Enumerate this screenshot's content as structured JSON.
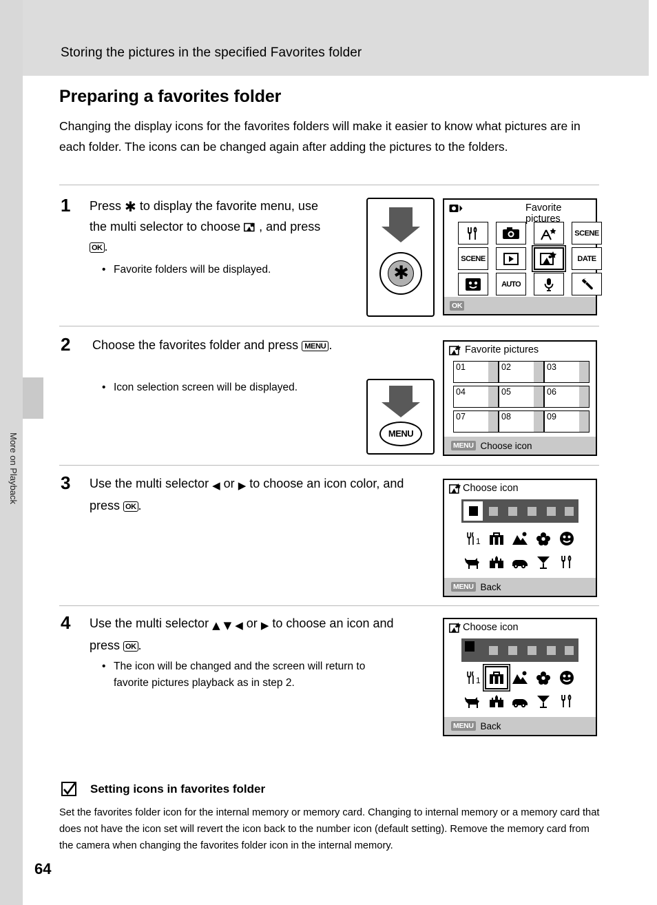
{
  "header": {
    "running_title": "Storing the pictures in the specified Favorites folder"
  },
  "page": {
    "number": "64",
    "side_label": "More on Playback",
    "title": "Preparing a favorites folder",
    "intro": "Changing the display icons for the favorites folders will make it easier to know what pictures are in each folder. The icons can be changed again after adding the pictures to the folders."
  },
  "steps": [
    {
      "num": "1",
      "text_1": "Press",
      "text_2": "to display the favorite menu, use the multi selector to choose",
      "text_3": ", and press",
      "text_4": ".",
      "bullet": "Favorite folders will be displayed.",
      "button_label": "multi-selector"
    },
    {
      "num": "2",
      "text_1": "Choose the favorites folder and press",
      "text_2": ".",
      "bullet": "Icon selection screen will be displayed.",
      "button_label": "MENU"
    },
    {
      "num": "3",
      "text_1": "Use the multi selector",
      "text_2": "or",
      "text_3": "to choose an icon color, and press",
      "text_4": "."
    },
    {
      "num": "4",
      "text_1": "Use the multi selector",
      "text_2": "or",
      "text_3": "to choose an icon and press",
      "text_4": ".",
      "bullet": "The icon will be changed and the screen will return to favorite pictures playback as in step 2."
    }
  ],
  "screens": {
    "favorite_menu": {
      "title": "Favorite pictures",
      "footer_ok": "OK",
      "icons": [
        "restaurant-icon",
        "camera-icon",
        "fireworks-icon",
        "scene-icon",
        "scene-mode-icon",
        "playback-icon",
        "favorites-icon",
        "date-icon",
        "portrait-icon",
        "auto-icon",
        "voice-icon",
        "setup-icon"
      ],
      "selected_index": 6
    },
    "folder_list": {
      "title": "Favorite pictures",
      "folders": [
        "01",
        "02",
        "03",
        "04",
        "05",
        "06",
        "07",
        "08",
        "09"
      ],
      "footer_badge": "MENU",
      "footer_text": "Choose icon"
    },
    "choose_icon_step3": {
      "title": "Choose icon",
      "footer_badge": "MENU",
      "footer_text": "Back",
      "color_count": 6,
      "selected_color_index": 0,
      "icons_row1": [
        "number-1-icon",
        "bag-icon",
        "mountain-icon",
        "flower-icon",
        "face-icon"
      ],
      "icons_row2": [
        "dog-icon",
        "castle-icon",
        "car-icon",
        "cocktail-icon",
        "cutlery-icon"
      ],
      "selected_icon_index": -1
    },
    "choose_icon_step4": {
      "title": "Choose icon",
      "footer_badge": "MENU",
      "footer_text": "Back",
      "color_count": 6,
      "selected_color_index": 0,
      "icons_row1": [
        "number-1-icon",
        "bag-icon",
        "mountain-icon",
        "flower-icon",
        "face-icon"
      ],
      "icons_row2": [
        "dog-icon",
        "castle-icon",
        "car-icon",
        "cocktail-icon",
        "cutlery-icon"
      ],
      "selected_icon_index": 1
    }
  },
  "note": {
    "title": "Setting icons in favorites folder",
    "body": "Set the favorites folder icon for the internal memory or memory card. Changing to internal memory or a memory card that does not have the icon set will revert the icon back to the number icon (default setting). Remove the memory card from the camera when changing the favorites folder icon in the internal memory."
  },
  "colors": {
    "header_band": "#dcdcdc",
    "page_edge": "#d8d8d8",
    "lcd_gray": "#c9c9c9",
    "badge_gray": "#8d8d8d"
  }
}
